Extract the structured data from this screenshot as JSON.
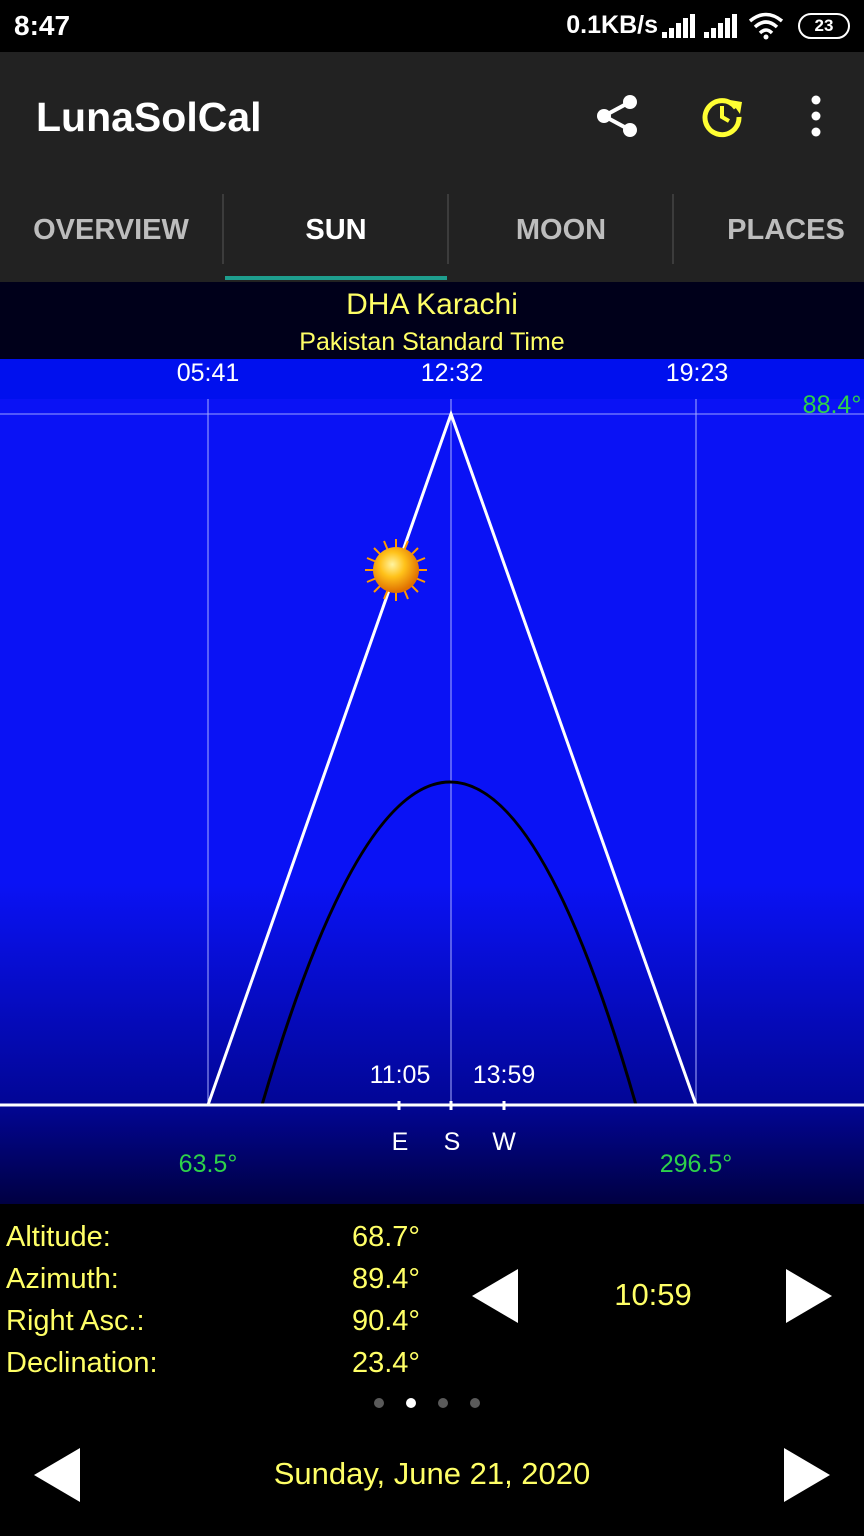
{
  "status_bar": {
    "time": "8:47",
    "network_speed": "0.1KB/s",
    "battery": "23"
  },
  "app_bar": {
    "title": "LunaSolCal",
    "icons": [
      "share-icon",
      "refresh-time-icon",
      "more-vert-icon"
    ]
  },
  "tabs": [
    {
      "label": "OVERVIEW"
    },
    {
      "label": "SUN"
    },
    {
      "label": "MOON"
    },
    {
      "label": "PLACES"
    }
  ],
  "active_tab": "SUN",
  "location": {
    "name": "DHA Karachi",
    "timezone": "Pakistan Standard Time"
  },
  "chart_data": {
    "type": "line",
    "top_times": {
      "sunrise": "05:41",
      "noon": "12:32",
      "sunset": "19:23"
    },
    "max_altitude": "88.4°",
    "bottom_times": {
      "east": "11:05",
      "west": "13:59"
    },
    "compass": [
      "E",
      "S",
      "W"
    ],
    "azimuths": {
      "sunrise": "63.5°",
      "sunset": "296.5°"
    },
    "series": [
      {
        "x": [
          "05:41",
          "12:32",
          "19:23"
        ],
        "y": [
          0,
          88.4,
          0
        ]
      },
      {
        "x": [
          "06:21",
          "12:32",
          "18:43"
        ],
        "y": [
          0,
          49,
          0
        ]
      }
    ],
    "sun_position": {
      "time": "10:59",
      "altitude": 68.7
    },
    "colors": {
      "sky": "#0a12f5",
      "sun_path": "#ffffff",
      "arc": "#000000",
      "azimuth_labels": "#2ed14a"
    }
  },
  "info": {
    "rows": [
      {
        "label": "Altitude:",
        "value": "68.7°"
      },
      {
        "label": "Azimuth:",
        "value": "89.4°"
      },
      {
        "label": "Right Asc.:",
        "value": "90.4°"
      },
      {
        "label": "Declination:",
        "value": "23.4°"
      }
    ]
  },
  "time_control": {
    "value": "10:59"
  },
  "pager": {
    "count": 4,
    "active": 1
  },
  "date_control": {
    "value": "Sunday, June 21, 2020"
  }
}
